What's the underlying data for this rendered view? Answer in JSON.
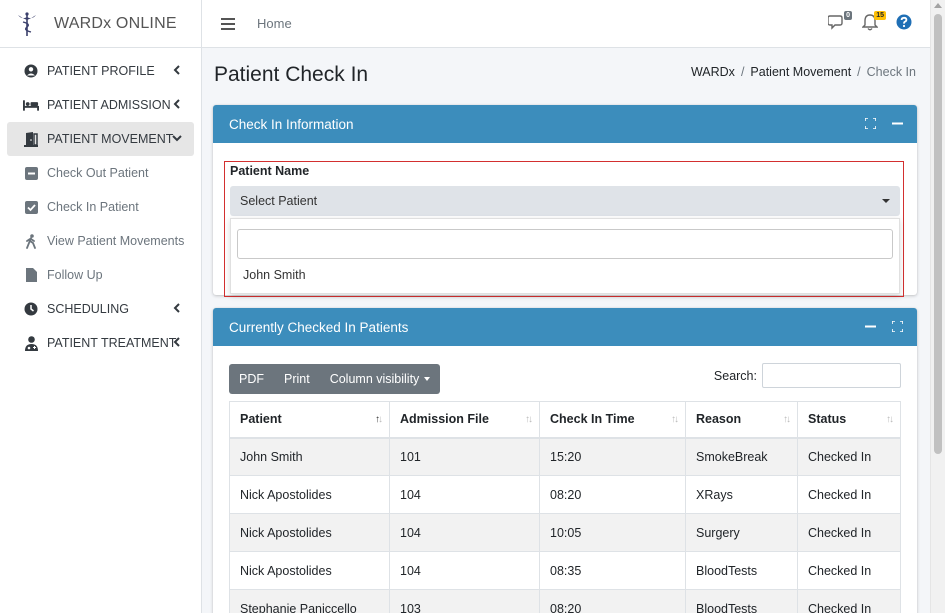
{
  "brand": {
    "name": "WARDx ONLINE",
    "logo_icon": "caduceus-icon"
  },
  "sidebar": {
    "items": [
      {
        "label": "PATIENT PROFILE",
        "icon": "user-circle-icon",
        "expandable": true
      },
      {
        "label": "PATIENT ADMISSION",
        "icon": "bed-icon",
        "expandable": true
      },
      {
        "label": "PATIENT MOVEMENT",
        "icon": "door-open-icon",
        "expandable": true,
        "expanded": true,
        "active": true
      },
      {
        "label": "Check Out Patient",
        "icon": "minus-square-icon",
        "sub": true
      },
      {
        "label": "Check In Patient",
        "icon": "check-square-icon",
        "sub": true
      },
      {
        "label": "View Patient Movements",
        "icon": "walking-icon",
        "sub": true
      },
      {
        "label": "Follow Up",
        "icon": "file-icon",
        "sub": true
      },
      {
        "label": "SCHEDULING",
        "icon": "clock-icon",
        "expandable": true
      },
      {
        "label": "PATIENT TREATMENT",
        "icon": "user-md-icon",
        "expandable": true
      }
    ]
  },
  "topbar": {
    "home": "Home",
    "messages_badge": "0",
    "notifications_badge": "15"
  },
  "page": {
    "title": "Patient Check In",
    "breadcrumb": [
      "WARDx",
      "Patient Movement",
      "Check In"
    ]
  },
  "checkin_card": {
    "title": "Check In Information",
    "field_label": "Patient Name",
    "select_value": "Select Patient",
    "options": [
      "John Smith"
    ]
  },
  "checked_in_card": {
    "title": "Currently Checked In Patients",
    "buttons": [
      "PDF",
      "Print",
      "Column visibility"
    ],
    "search_label": "Search:",
    "columns": [
      "Patient",
      "Admission File",
      "Check In Time",
      "Reason",
      "Status"
    ],
    "rows": [
      [
        "John Smith",
        "101",
        "15:20",
        "SmokeBreak",
        "Checked In"
      ],
      [
        "Nick Apostolides",
        "104",
        "08:20",
        "XRays",
        "Checked In"
      ],
      [
        "Nick Apostolides",
        "104",
        "10:05",
        "Surgery",
        "Checked In"
      ],
      [
        "Nick Apostolides",
        "104",
        "08:35",
        "BloodTests",
        "Checked In"
      ],
      [
        "Stephanie Paniccello",
        "103",
        "08:20",
        "BloodTests",
        "Checked In"
      ]
    ]
  },
  "colors": {
    "header_blue": "#3c8dbc",
    "button_gray": "#6c757d",
    "badge_warning": "#ffc107"
  }
}
